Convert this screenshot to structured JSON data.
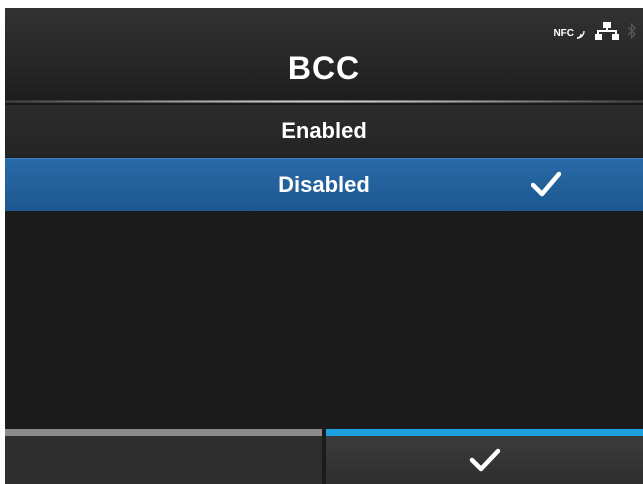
{
  "screen": {
    "title": "BCC"
  },
  "status_bar": {
    "nfc_label": "NFC",
    "icons": [
      "nfc-icon",
      "network-icon",
      "bluetooth-icon"
    ]
  },
  "options": [
    {
      "label": "Enabled",
      "selected": false
    },
    {
      "label": "Disabled",
      "selected": true
    }
  ],
  "footer": {
    "left_button_icon": "",
    "right_button_icon": "checkmark-icon"
  },
  "colors": {
    "selected_row": "#1f5d98",
    "active_accent": "#1ea0e0",
    "inactive_accent": "#8c8c8c",
    "background": "#1b1b1b"
  }
}
